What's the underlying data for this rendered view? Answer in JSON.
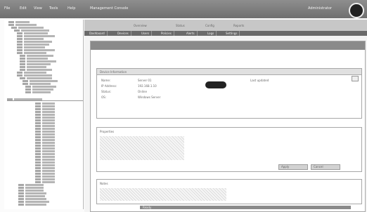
{
  "menu": [
    "File",
    "Edit",
    "View",
    "Tools",
    "Help"
  ],
  "window_title": "Management Console",
  "user": "Administrator",
  "toolbar_tabs": [
    "Overview",
    "Status",
    "Config",
    "Reports"
  ],
  "tabs": [
    "Dashboard",
    "Devices",
    "Users",
    "Policies",
    "Alerts",
    "Logs",
    "Settings"
  ],
  "detail": {
    "title": "Device Information",
    "fields": [
      {
        "label": "Name:",
        "value": "Server 01"
      },
      {
        "label": "IP Address:",
        "value": "192.168.1.10"
      },
      {
        "label": "Status:",
        "value": "Online"
      },
      {
        "label": "OS:",
        "value": "Windows Server"
      }
    ],
    "note": "Last updated"
  },
  "section2": {
    "title": "Properties"
  },
  "section3": {
    "title": "Notes"
  },
  "buttons": [
    "Apply",
    "Cancel"
  ],
  "footer": "Ready"
}
